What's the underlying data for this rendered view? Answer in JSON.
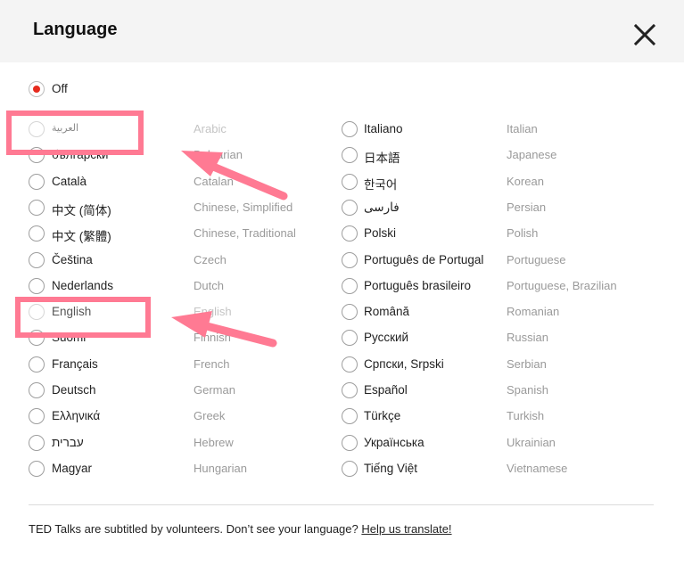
{
  "dialog": {
    "title": "Language",
    "off_label": "Off",
    "footer_text": "TED Talks are subtitled by volunteers. Don’t see your language?",
    "footer_link": "Help us translate!"
  },
  "colors": {
    "accent_red": "#e62b1e",
    "annotation_pink": "#ff7a93",
    "header_bg": "#f4f4f4"
  },
  "languages_left": [
    {
      "native": "العربية",
      "english": "Arabic"
    },
    {
      "native": "български",
      "english": "Bulgarian"
    },
    {
      "native": "Català",
      "english": "Catalan"
    },
    {
      "native": "中文 (简体)",
      "english": "Chinese, Simplified"
    },
    {
      "native": "中文 (繁體)",
      "english": "Chinese, Traditional"
    },
    {
      "native": "Čeština",
      "english": "Czech"
    },
    {
      "native": "Nederlands",
      "english": "Dutch"
    },
    {
      "native": "English",
      "english": "English"
    },
    {
      "native": "Suomi",
      "english": "Finnish"
    },
    {
      "native": "Français",
      "english": "French"
    },
    {
      "native": "Deutsch",
      "english": "German"
    },
    {
      "native": "Ελληνικά",
      "english": "Greek"
    },
    {
      "native": "עברית",
      "english": "Hebrew"
    },
    {
      "native": "Magyar",
      "english": "Hungarian"
    }
  ],
  "languages_right": [
    {
      "native": "Italiano",
      "english": "Italian"
    },
    {
      "native": "日本語",
      "english": "Japanese"
    },
    {
      "native": "한국어",
      "english": "Korean"
    },
    {
      "native": "فارسى",
      "english": "Persian"
    },
    {
      "native": "Polski",
      "english": "Polish"
    },
    {
      "native": "Português de Portugal",
      "english": "Portuguese"
    },
    {
      "native": "Português brasileiro",
      "english": "Portuguese, Brazilian"
    },
    {
      "native": "Română",
      "english": "Romanian"
    },
    {
      "native": "Русский",
      "english": "Russian"
    },
    {
      "native": "Српски, Srpski",
      "english": "Serbian"
    },
    {
      "native": "Español",
      "english": "Spanish"
    },
    {
      "native": "Türkçe",
      "english": "Turkish"
    },
    {
      "native": "Українська",
      "english": "Ukrainian"
    },
    {
      "native": "Tiếng Việt",
      "english": "Vietnamese"
    }
  ]
}
